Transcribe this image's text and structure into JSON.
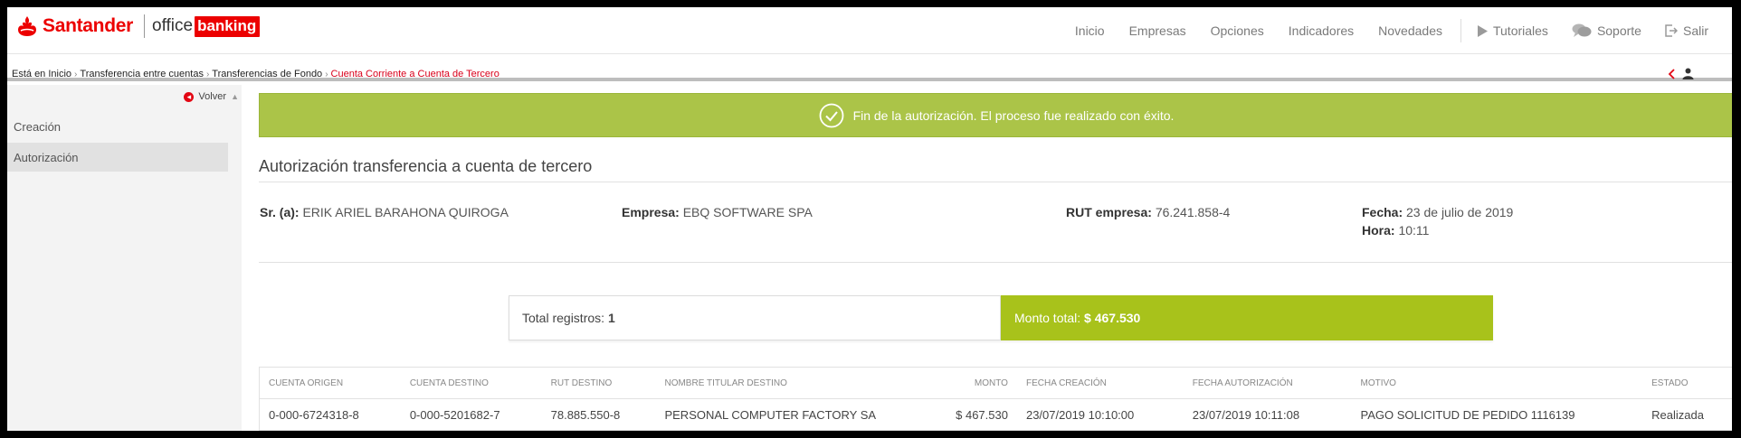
{
  "header": {
    "brand": "Santander",
    "product_office": "office",
    "product_banking": "banking",
    "nav": [
      "Inicio",
      "Empresas",
      "Opciones",
      "Indicadores",
      "Novedades"
    ],
    "tutoriales": "Tutoriales",
    "soporte": "Soporte",
    "salir": "Salir"
  },
  "breadcrumb": {
    "items": [
      "Está en Inicio",
      "Transferencia entre cuentas",
      "Transferencias de Fondo"
    ],
    "current": "Cuenta Corriente a Cuenta de Tercero"
  },
  "sidebar": {
    "back_label": "Volver",
    "items": [
      {
        "label": "Creación"
      },
      {
        "label": "Autorización"
      }
    ]
  },
  "success_message": "Fin de la autorización. El proceso fue realizado con éxito.",
  "page_title": "Autorización transferencia a cuenta de tercero",
  "info": {
    "sr_label": "Sr. (a):",
    "sr_value": "ERIK ARIEL BARAHONA QUIROGA",
    "empresa_label": "Empresa:",
    "empresa_value": "EBQ SOFTWARE SPA",
    "rut_label": "RUT empresa:",
    "rut_value": "76.241.858-4",
    "fecha_label": "Fecha:",
    "fecha_value": "23 de julio de 2019",
    "hora_label": "Hora:",
    "hora_value": "10:11"
  },
  "totals": {
    "registros_label": "Total registros:",
    "registros_value": "1",
    "monto_label": "Monto total:",
    "monto_value": "$ 467.530"
  },
  "table": {
    "headers": [
      "Cuenta origen",
      "Cuenta destino",
      "RUT destino",
      "Nombre titular destino",
      "Monto",
      "Fecha creación",
      "Fecha autorización",
      "Motivo",
      "Estado"
    ],
    "rows": [
      [
        "0-000-6724318-8",
        "0-000-5201682-7",
        "78.885.550-8",
        "PERSONAL COMPUTER FACTORY SA",
        "$ 467.530",
        "23/07/2019 10:10:00",
        "23/07/2019 10:11:08",
        "PAGO SOLICITUD DE PEDIDO 1116139",
        "Realizada"
      ]
    ]
  },
  "colors": {
    "brand_red": "#ec0000",
    "success_green": "#abc448",
    "total_green": "#a8c21b"
  }
}
